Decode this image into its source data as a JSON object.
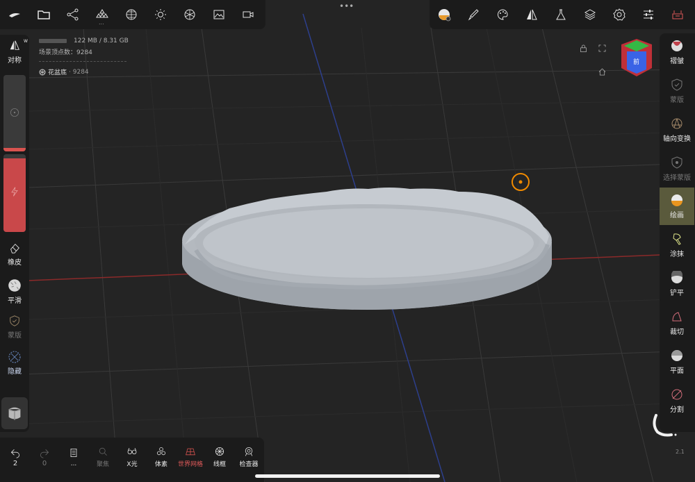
{
  "top_toolbar": {
    "left_icons": [
      "sculpt-logo-icon",
      "folder-icon",
      "share-nodes-icon",
      "primitives-icon",
      "sphere-grid-icon",
      "sun-icon",
      "material-icon",
      "image-icon",
      "camera-icon"
    ],
    "sub_dots": "...",
    "center_handle": "•••",
    "right_icons": [
      "material-sphere-icon",
      "brush-icon",
      "palette-icon",
      "symmetry-icon",
      "flask-icon",
      "layers-icon",
      "settings-gear-icon",
      "sliders-icon",
      "scene-icon"
    ]
  },
  "stats": {
    "memory": "122 MB / 8.31 GB",
    "scene_vertices": "场景顶点数：9284",
    "object_name": "花盆底",
    "object_vertices": "· 9284"
  },
  "left_panel": {
    "symmetry_label": "对称",
    "symmetry_badge": "W",
    "radius_level": 0.05,
    "intensity_level": 0.95,
    "eraser_label": "橡皮",
    "smooth_label": "平滑",
    "mask_label": "蒙版",
    "hide_label": "隐藏"
  },
  "right_panel": {
    "items": [
      {
        "label": "褶皱",
        "icon": "crease-icon",
        "state": "normal"
      },
      {
        "label": "蒙版",
        "icon": "mask-icon",
        "state": "disabled"
      },
      {
        "label": "轴向变换",
        "icon": "axis-transform-icon",
        "state": "normal"
      },
      {
        "label": "选择蒙版",
        "icon": "select-mask-icon",
        "state": "disabled"
      },
      {
        "label": "绘画",
        "icon": "paint-icon",
        "state": "active"
      },
      {
        "label": "涂抹",
        "icon": "smudge-icon",
        "state": "normal"
      },
      {
        "label": "铲平",
        "icon": "flatten-icon",
        "state": "normal"
      },
      {
        "label": "裁切",
        "icon": "trim-icon",
        "state": "normal"
      },
      {
        "label": "平面",
        "icon": "plane-icon",
        "state": "normal"
      },
      {
        "label": "分割",
        "icon": "split-icon",
        "state": "normal"
      }
    ]
  },
  "nav_cube": {
    "front_label": "前"
  },
  "bottom_toolbar": {
    "undo_count": "2",
    "redo_count": "0",
    "items": [
      {
        "label": "...",
        "icon": "history-icon",
        "state": "normal"
      },
      {
        "label": "聚焦",
        "icon": "focus-icon",
        "state": "disabled"
      },
      {
        "label": "X光",
        "icon": "xray-icon",
        "state": "normal"
      },
      {
        "label": "体素",
        "icon": "voxel-icon",
        "state": "normal"
      },
      {
        "label": "世界网格",
        "icon": "world-grid-icon",
        "state": "active"
      },
      {
        "label": "线框",
        "icon": "wireframe-icon",
        "state": "normal"
      },
      {
        "label": "检查器",
        "icon": "inspector-icon",
        "state": "normal"
      }
    ]
  },
  "version": "2.1",
  "colors": {
    "accent_red": "#d9534f",
    "active_tool_bg": "#5a5a3c",
    "grid_line": "#3a3a3a",
    "axis_red": "#8c2a2a",
    "axis_blue": "#2d3f8c",
    "mesh": "#b9bec4",
    "cursor_orange": "#f08a00"
  }
}
